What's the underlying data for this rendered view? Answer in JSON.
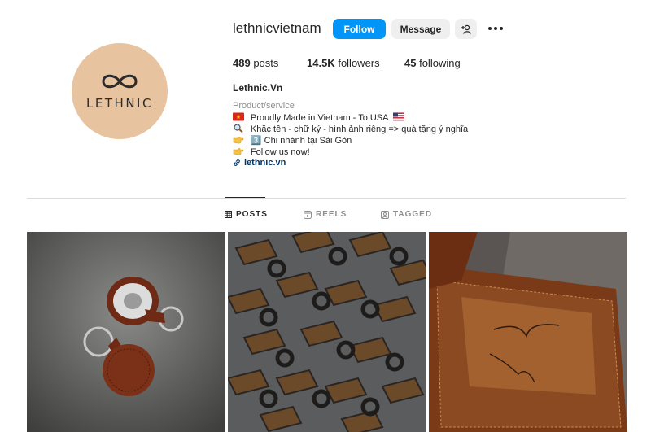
{
  "profile": {
    "username": "lethnicvietnam",
    "avatar_text": "LETHNIC",
    "follow_label": "Follow",
    "message_label": "Message",
    "full_name": "Lethnic.Vn",
    "category": "Product/service",
    "bio": [
      {
        "icon": "vietnam-flag-icon",
        "text": "| Proudly Made in Vietnam - To USA"
      },
      {
        "icon": "magnifier-icon",
        "text": "| Khắc tên - chữ ký - hình ảnh riêng => quà tặng ý nghĩa"
      },
      {
        "icon": "pointing-hand-icon",
        "text": "| 3️⃣ Chi nhánh tại Sài Gòn"
      },
      {
        "icon": "pointing-hand-icon",
        "text": "| Follow us now!"
      }
    ],
    "link": "lethnic.vn"
  },
  "stats": {
    "posts_count": "489",
    "posts_label": "posts",
    "followers_count": "14.5K",
    "followers_label": "followers",
    "following_count": "45",
    "following_label": "following"
  },
  "tabs": [
    {
      "label": "POSTS",
      "icon": "grid-icon",
      "active": true
    },
    {
      "label": "REELS",
      "icon": "reels-icon",
      "active": false
    },
    {
      "label": "TAGGED",
      "icon": "tagged-icon",
      "active": false
    }
  ],
  "posts": [
    {
      "subject": "leather airtag keychains"
    },
    {
      "subject": "leather keychain clips"
    },
    {
      "subject": "engraved leather wallet"
    }
  ],
  "colors": {
    "accent": "#0095f6",
    "avatar_bg": "#e8c39f",
    "link": "#00376b",
    "muted": "#8e8e8e"
  }
}
